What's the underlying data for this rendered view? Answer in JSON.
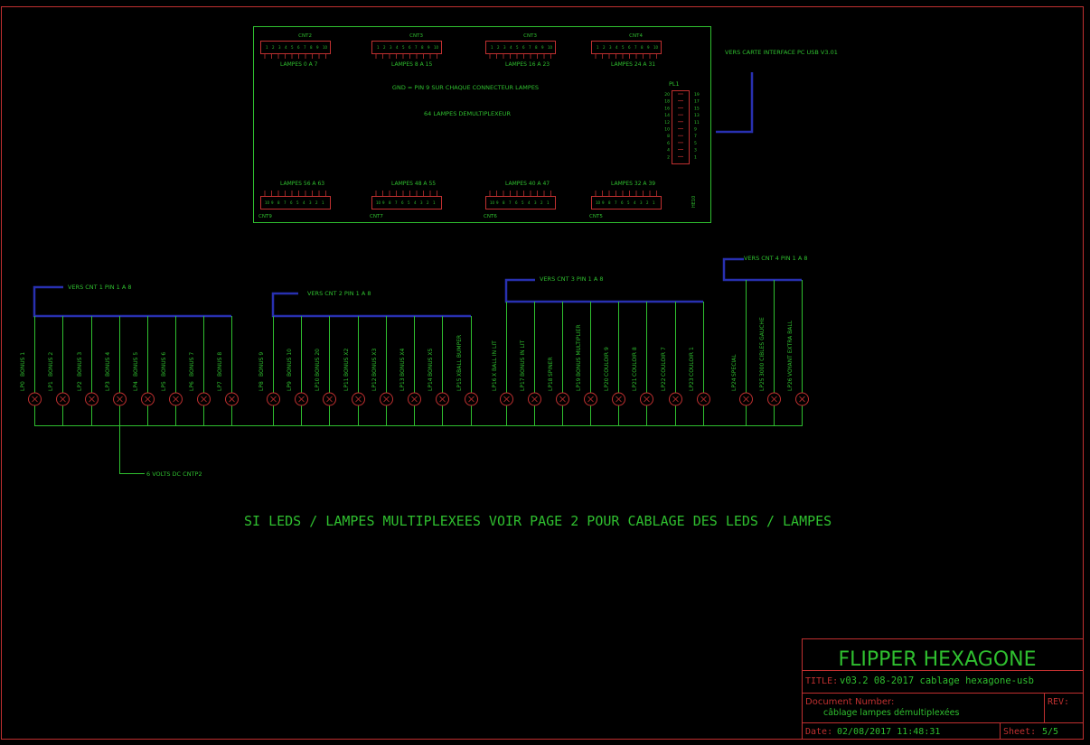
{
  "board": {
    "top_connectors": [
      {
        "ref": "CNT2",
        "label": "LAMPES 0 A 7"
      },
      {
        "ref": "CNT3",
        "label": "LAMPES 8 A 15"
      },
      {
        "ref": "CNT3",
        "label": "LAMPES 16 A 23"
      },
      {
        "ref": "CNT4",
        "label": "LAMPES 24 A 31"
      }
    ],
    "bottom_connectors": [
      {
        "ref": "CNT9",
        "label": "LAMPES 56 A 63"
      },
      {
        "ref": "CNT7",
        "label": "LAMPES 48 A 55"
      },
      {
        "ref": "CNT6",
        "label": "LAMPES 40 A 47"
      },
      {
        "ref": "CNT5",
        "label": "LAMPES 32 A 39"
      }
    ],
    "top_pins": [
      "1",
      "2",
      "3",
      "4",
      "5",
      "6",
      "7",
      "8",
      "9",
      "10"
    ],
    "bottom_pins": [
      "10",
      "9",
      "8",
      "7",
      "6",
      "5",
      "4",
      "3",
      "2",
      "1"
    ],
    "note_gnd": "GND = PIN 9 SUR CHAQUE CONNECTEUR LAMPES",
    "note_demux": "64 LAMPES DEMULTIPLEXEUR",
    "header_ref": "PL1",
    "header_left_pins": [
      "20",
      "18",
      "16",
      "14",
      "12",
      "10",
      "8",
      "6",
      "4",
      "2"
    ],
    "header_right_pins": [
      "19",
      "17",
      "15",
      "13",
      "11",
      "9",
      "7",
      "5",
      "3",
      "1"
    ],
    "header_type": "HE10",
    "interface_label": "VERS CARTE INTERFACE PC USB V3.01"
  },
  "groups": [
    {
      "label": "VERS CNT 1 PIN 1 A 8"
    },
    {
      "label": "VERS CNT 2 PIN 1 A 8"
    },
    {
      "label": "VERS CNT 3 PIN 1 A 8"
    },
    {
      "label": "VERS CNT 4 PIN 1 A 8"
    }
  ],
  "lamps": [
    {
      "ref": "LP0",
      "name": "BONUS 1"
    },
    {
      "ref": "LP1",
      "name": "BONUS 2"
    },
    {
      "ref": "LP2",
      "name": "BONUS 3"
    },
    {
      "ref": "LP3",
      "name": "BONUS 4"
    },
    {
      "ref": "LP4",
      "name": "BONUS 5"
    },
    {
      "ref": "LP5",
      "name": "BONUS 6"
    },
    {
      "ref": "LP6",
      "name": "BONUS 7"
    },
    {
      "ref": "LP7",
      "name": "BONUS 8"
    },
    {
      "ref": "LP8",
      "name": "BONUS 9"
    },
    {
      "ref": "LP9",
      "name": "BONUS 10"
    },
    {
      "ref": "LP10",
      "name": "BONUS 20"
    },
    {
      "ref": "LP11",
      "name": "BONUS X2"
    },
    {
      "ref": "LP12",
      "name": "BONUS X3"
    },
    {
      "ref": "LP13",
      "name": "BONUS X4"
    },
    {
      "ref": "LP14",
      "name": "BONUS X5"
    },
    {
      "ref": "LP15",
      "name": "XBALL BUMPER"
    },
    {
      "ref": "LP16",
      "name": "X BALL IN LIT"
    },
    {
      "ref": "LP17",
      "name": "BONUS IN LIT"
    },
    {
      "ref": "LP18",
      "name": "SPINER"
    },
    {
      "ref": "LP19",
      "name": "BONUS MULTIPLIER"
    },
    {
      "ref": "LP20",
      "name": "COULOIR 9"
    },
    {
      "ref": "LP21",
      "name": "COULOIR 8"
    },
    {
      "ref": "LP22",
      "name": "COULOIR 7"
    },
    {
      "ref": "LP23",
      "name": "COULOIR 1"
    },
    {
      "ref": "LP24",
      "name": "SPECIAL"
    },
    {
      "ref": "LP25",
      "name": "3000 CIBLES GAUCHE"
    },
    {
      "ref": "LP26",
      "name": "VOYANT EXTRA BALL"
    }
  ],
  "supply_label": "6 VOLTS DC CNTP2",
  "main_note": "SI LEDS / LAMPES MULTIPLEXEES VOIR PAGE 2 POUR CABLAGE DES LEDS / LAMPES",
  "title_block": {
    "project": "FLIPPER HEXAGONE",
    "title_label": "TITLE:",
    "title_value": "v03.2 08-2017 cablage hexagone-usb",
    "doc_label": "Document Number:",
    "doc_value": "câblage lampes démultiplexées",
    "rev_label": "REV:",
    "date_label": "Date:",
    "date_value": "02/08/2017 11:48:31",
    "sheet_label": "Sheet:",
    "sheet_value": "5/5"
  },
  "colors": {
    "wire": "#2fbf2f",
    "part": "#c03030",
    "bus": "#2830b0",
    "text": "#2fbf2f",
    "background": "#000000"
  }
}
